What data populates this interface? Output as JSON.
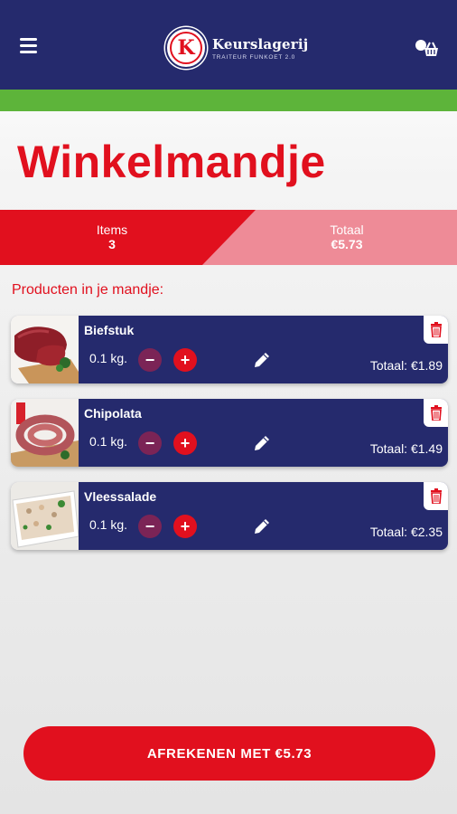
{
  "header": {
    "brand_title": "Keurslagerij",
    "brand_subtitle": "TRAITEUR FUNKOET 2.0",
    "logo_letter": "K"
  },
  "page": {
    "title": "Winkelmandje"
  },
  "summary": {
    "items_label": "Items",
    "items_value": "3",
    "total_label": "Totaal",
    "total_value": "€5.73"
  },
  "section_label": "Producten in je mandje:",
  "products": [
    {
      "name": "Biefstuk",
      "qty": "0.1 kg.",
      "total": "Totaal: €1.89"
    },
    {
      "name": "Chipolata",
      "qty": "0.1 kg.",
      "total": "Totaal: €1.49"
    },
    {
      "name": "Vleessalade",
      "qty": "0.1 kg.",
      "total": "Totaal: €2.35"
    }
  ],
  "checkout": {
    "label": "AFREKENEN MET €5.73"
  },
  "colors": {
    "navy": "#252a6d",
    "red": "#e1101e",
    "green": "#5db43a",
    "pink": "#ee8b97"
  },
  "icons": [
    "menu-icon",
    "cart-icon",
    "minus-icon",
    "plus-icon",
    "pencil-icon",
    "trash-icon"
  ]
}
